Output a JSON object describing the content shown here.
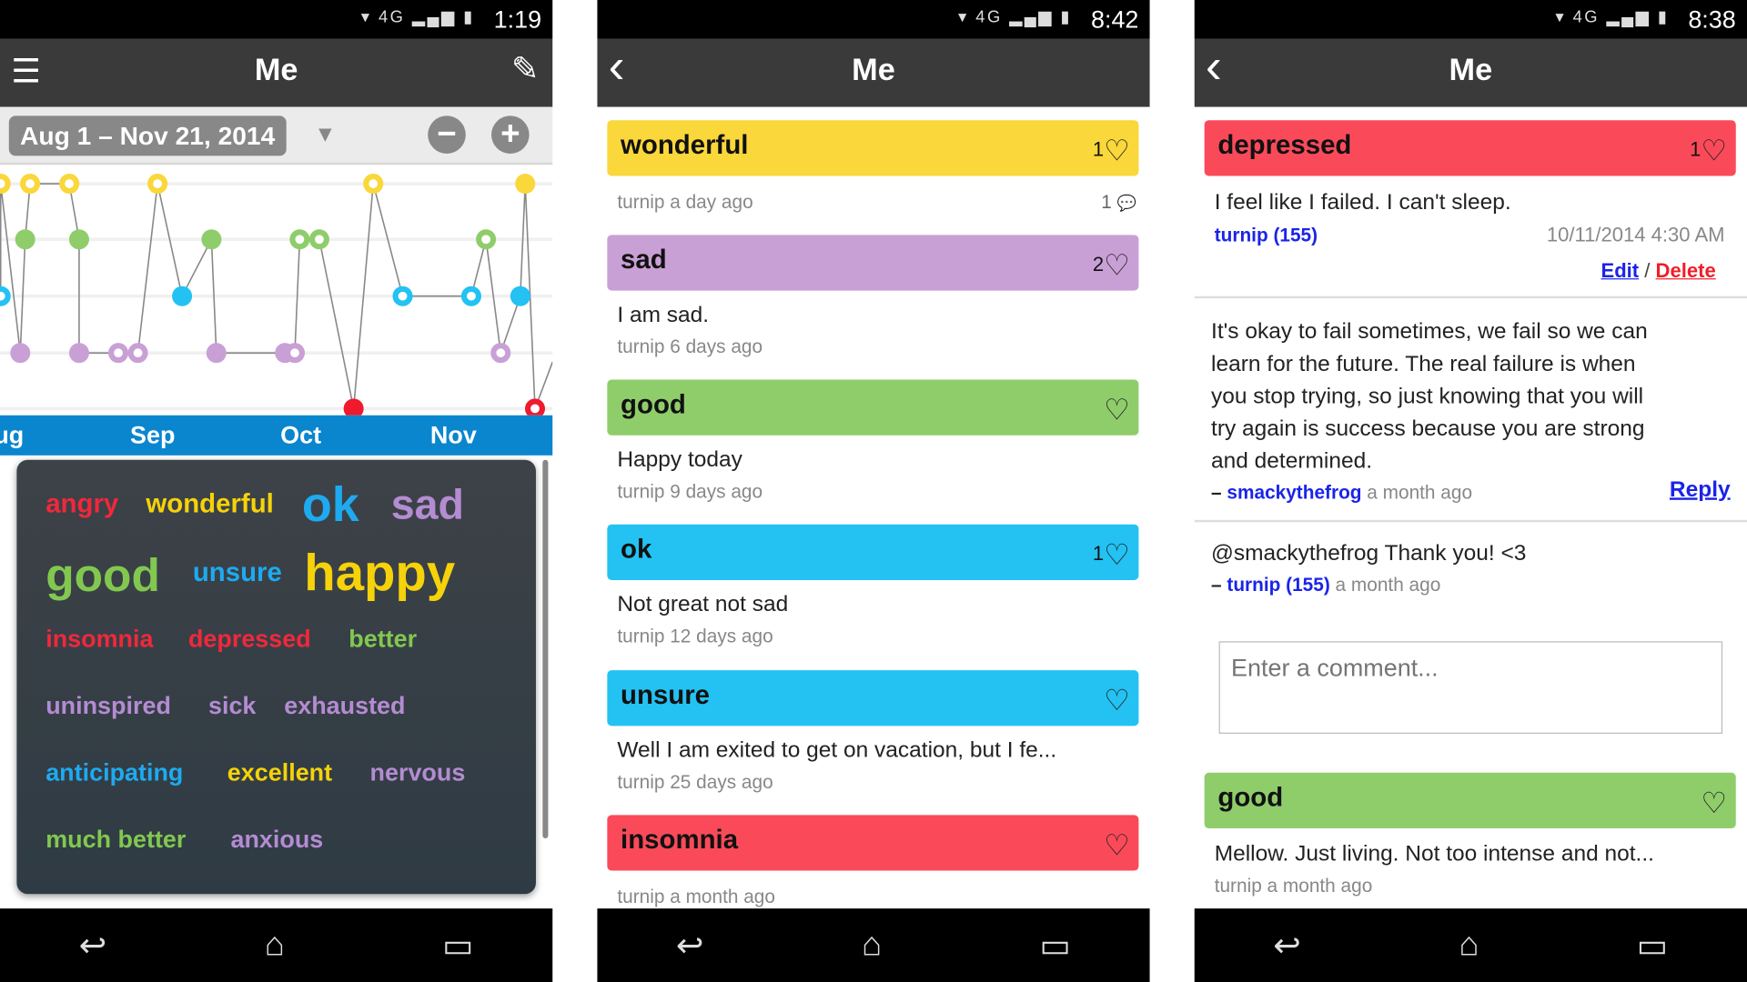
{
  "colors": {
    "yellow": "#fad73a",
    "purple": "#c9a0d6",
    "green": "#8fcd6b",
    "blue": "#23c2f3",
    "red": "#fa4a5a",
    "axis": "#0a86cf",
    "appbar": "#3a3a3a"
  },
  "screens": [
    {
      "status": {
        "time": "1:19",
        "icons": "wifi 4G LTE signal battery"
      },
      "title": "Me",
      "left_icon": "☰",
      "right_icon": "✎",
      "date_range": "Aug 1 – Nov 21, 2014",
      "zoom_out": "−",
      "zoom_in": "+",
      "months": [
        "ug",
        "Sep",
        "Oct",
        "Nov"
      ],
      "words": [
        {
          "t": "angry",
          "c": "#f0283c"
        },
        {
          "t": "wonderful",
          "c": "#f5d20a"
        },
        {
          "t": "ok",
          "c": "#1eaaf0"
        },
        {
          "t": "sad",
          "c": "#b48cd2"
        },
        {
          "t": "good",
          "c": "#82c850"
        },
        {
          "t": "unsure",
          "c": "#1eaaf0"
        },
        {
          "t": "happy",
          "c": "#f5d20a"
        },
        {
          "t": "insomnia",
          "c": "#f0283c"
        },
        {
          "t": "depressed",
          "c": "#f0283c"
        },
        {
          "t": "better",
          "c": "#82c850"
        },
        {
          "t": "uninspired",
          "c": "#b48cd2"
        },
        {
          "t": "sick",
          "c": "#b48cd2"
        },
        {
          "t": "exhausted",
          "c": "#b48cd2"
        },
        {
          "t": "anticipating",
          "c": "#1eaaf0"
        },
        {
          "t": "excellent",
          "c": "#f5d20a"
        },
        {
          "t": "nervous",
          "c": "#b48cd2"
        },
        {
          "t": "much better",
          "c": "#82c850"
        },
        {
          "t": "anxious",
          "c": "#b48cd2"
        }
      ]
    },
    {
      "status": {
        "time": "8:42"
      },
      "title": "Me",
      "left_icon": "‹",
      "entries": [
        {
          "mood": "wonderful",
          "likes": "1",
          "body": "",
          "meta": "turnip a day ago",
          "comments": "1"
        },
        {
          "mood": "sad",
          "likes": "2",
          "body": "I am sad.",
          "meta": "turnip 6 days ago"
        },
        {
          "mood": "good",
          "likes": "",
          "body": "Happy today",
          "meta": "turnip 9 days ago"
        },
        {
          "mood": "ok",
          "likes": "1",
          "body": "Not great not sad",
          "meta": "turnip 12 days ago"
        },
        {
          "mood": "unsure",
          "likes": "",
          "body": "Well I am exited to get on vacation, but I fe...",
          "meta": "turnip 25 days ago"
        },
        {
          "mood": "insomnia",
          "likes": "",
          "body": "",
          "meta": "turnip a month ago"
        }
      ]
    },
    {
      "status": {
        "time": "8:38"
      },
      "title": "Me",
      "left_icon": "‹",
      "post": {
        "mood": "depressed",
        "likes": "1",
        "body": "I feel like I failed. I can't sleep.",
        "user": "turnip (155)",
        "date": "10/11/2014 4:30 AM",
        "edit": "Edit",
        "sep": "/",
        "delete": "Delete"
      },
      "comments": [
        {
          "lines": [
            "It's okay to fail sometimes, we fail so we can",
            "learn for the future. The real failure is when",
            "you stop trying, so just knowing that you will",
            "try again is success because you are strong",
            "and determined."
          ],
          "dash": "–",
          "user": "smackythefrog",
          "when": "a month ago",
          "reply": "Reply"
        },
        {
          "lines": [
            "@smackythefrog Thank you! <3"
          ],
          "dash": "–",
          "user": "turnip (155)",
          "when": "a month ago"
        }
      ],
      "comment_placeholder": "Enter a comment...",
      "next": {
        "mood": "good",
        "body": "Mellow. Just living. Not too intense and not...",
        "meta": "turnip a month ago"
      }
    }
  ],
  "nav": {
    "back": "↩",
    "home": "⌂",
    "recents": "▭"
  },
  "heart": "♡",
  "comment_icon": "💬",
  "chart_data": {
    "type": "line",
    "x_range": [
      "2014-08-01",
      "2014-11-21"
    ],
    "levels": [
      "wonderful",
      "good",
      "ok",
      "sad",
      "depressed"
    ],
    "points": [
      {
        "d": "2014-08-01",
        "m": "ok",
        "h": true
      },
      {
        "d": "2014-08-01",
        "m": "wonderful",
        "h": true
      },
      {
        "d": "2014-08-05",
        "m": "sad",
        "h": false
      },
      {
        "d": "2014-08-06",
        "m": "good",
        "h": false
      },
      {
        "d": "2014-08-07",
        "m": "wonderful",
        "h": true
      },
      {
        "d": "2014-08-15",
        "m": "wonderful",
        "h": true
      },
      {
        "d": "2014-08-17",
        "m": "good",
        "h": false
      },
      {
        "d": "2014-08-17",
        "m": "sad",
        "h": false
      },
      {
        "d": "2014-08-25",
        "m": "sad",
        "h": true
      },
      {
        "d": "2014-08-29",
        "m": "sad",
        "h": true
      },
      {
        "d": "2014-09-02",
        "m": "wonderful",
        "h": true
      },
      {
        "d": "2014-09-07",
        "m": "ok",
        "h": false
      },
      {
        "d": "2014-09-13",
        "m": "good",
        "h": false
      },
      {
        "d": "2014-09-14",
        "m": "sad",
        "h": false
      },
      {
        "d": "2014-09-28",
        "m": "sad",
        "h": false
      },
      {
        "d": "2014-09-30",
        "m": "sad",
        "h": true
      },
      {
        "d": "2014-10-01",
        "m": "good",
        "h": true
      },
      {
        "d": "2014-10-05",
        "m": "good",
        "h": true
      },
      {
        "d": "2014-10-12",
        "m": "depressed",
        "h": false
      },
      {
        "d": "2014-10-16",
        "m": "wonderful",
        "h": true
      },
      {
        "d": "2014-10-22",
        "m": "ok",
        "h": true
      },
      {
        "d": "2014-11-05",
        "m": "ok",
        "h": true
      },
      {
        "d": "2014-11-08",
        "m": "good",
        "h": true
      },
      {
        "d": "2014-11-11",
        "m": "sad",
        "h": true
      },
      {
        "d": "2014-11-15",
        "m": "ok",
        "h": false
      },
      {
        "d": "2014-11-16",
        "m": "wonderful",
        "h": false
      },
      {
        "d": "2014-11-18",
        "m": "depressed",
        "h": true
      }
    ]
  }
}
